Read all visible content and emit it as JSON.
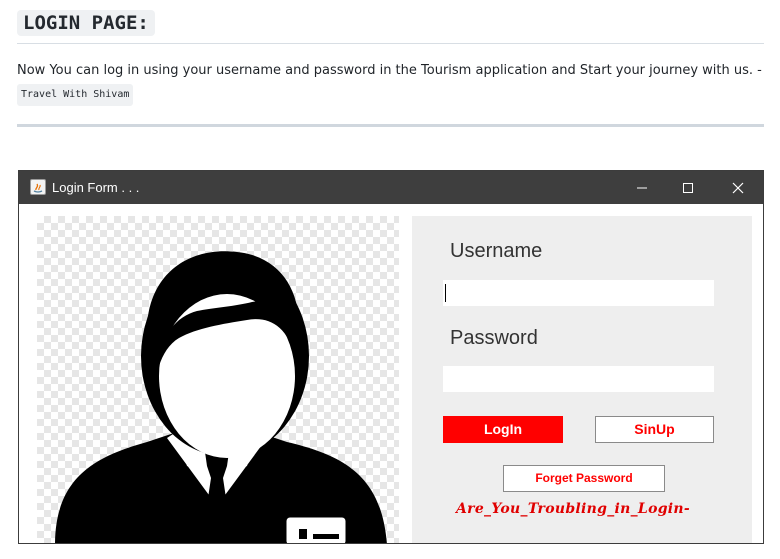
{
  "doc": {
    "heading": "LOGIN PAGE:",
    "paragraph": "Now You can log in using your username and password in the Tourism application and Start your journey with us. -",
    "signature_code": "Travel With Shivam"
  },
  "window": {
    "title": "Login Form . . .",
    "controls": [
      "minimize-icon",
      "maximize-icon",
      "close-icon"
    ],
    "form": {
      "username_label": "Username",
      "username_value": "",
      "password_label": "Password",
      "password_value": "",
      "login_label": "LogIn",
      "signup_label": "SinUp",
      "forget_label": "Forget Password",
      "trouble_text": "Are_You_Troubling_in_Login-"
    },
    "image": "user-avatar-icon"
  },
  "colors": {
    "accent_red": "#ff0000",
    "titlebar": "#3e3e3e",
    "panel": "#eeeeee"
  }
}
